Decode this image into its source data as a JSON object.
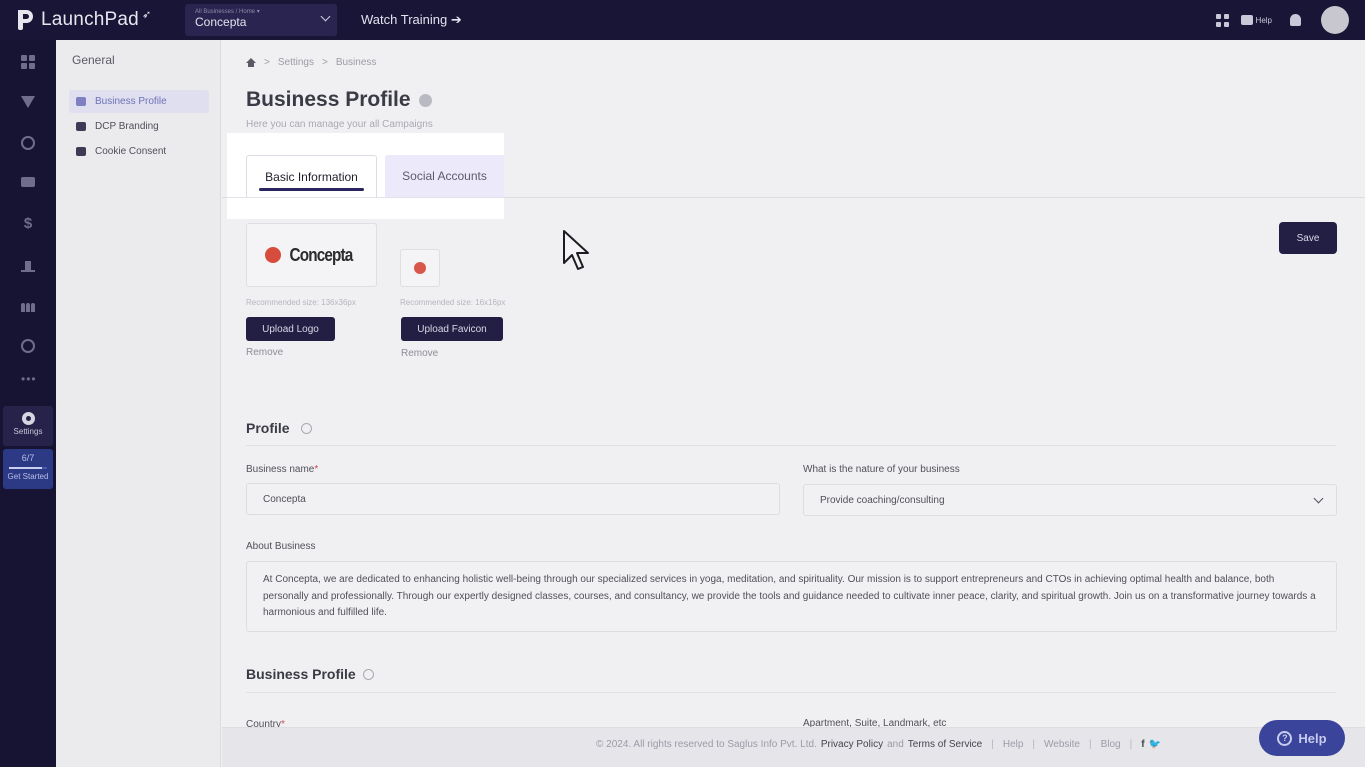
{
  "brand": {
    "name": "LaunchPad",
    "leaf_glyph": "➶"
  },
  "topbar": {
    "business_small": "All Businesses / Home ▾",
    "business_name": "Concepta",
    "watch_training": "Watch Training ➔",
    "help_label": "Help"
  },
  "rail": {
    "settings_label": "Settings",
    "progress_count": "6/7",
    "progress_fraction": 0.857,
    "get_started": "Get Started",
    "more": "•••"
  },
  "subnav": {
    "title": "General",
    "items": [
      {
        "label": "Business Profile",
        "active": true
      },
      {
        "label": "DCP Branding",
        "active": false
      },
      {
        "label": "Cookie Consent",
        "active": false
      }
    ]
  },
  "breadcrumb": {
    "items": [
      "Settings",
      "Business"
    ],
    "sep": ">"
  },
  "page": {
    "title": "Business Profile",
    "subtitle": "Here you can manage your all Campaigns"
  },
  "tabs": [
    {
      "label": "Basic Information",
      "active": true
    },
    {
      "label": "Social Accounts",
      "active": false
    }
  ],
  "branding": {
    "logo_text": "Concepta",
    "logo_rec": "Recommended size: 136x36px",
    "favicon_rec": "Recommended size: 16x16px",
    "upload_logo": "Upload Logo",
    "upload_favicon": "Upload Favicon",
    "remove": "Remove",
    "save": "Save"
  },
  "profile": {
    "section_title": "Profile",
    "business_name_label": "Business name",
    "business_name_value": "Concepta",
    "nature_label": "What is the nature of your business",
    "nature_value": "Provide coaching/consulting",
    "about_label": "About Business",
    "about_value": "At Concepta, we are dedicated to enhancing holistic well-being through our specialized services in yoga, meditation, and spirituality. Our mission is to support entrepreneurs and CTOs in achieving optimal health and balance, both personally and professionally. Through our expertly designed classes, courses, and consultancy, we provide the tools and guidance needed to cultivate inner peace, clarity, and spiritual growth. Join us on a transformative journey towards a harmonious and fulfilled life."
  },
  "business_profile": {
    "section_title": "Business Profile",
    "country_label": "Country",
    "apartment_label": "Apartment, Suite, Landmark, etc"
  },
  "footer": {
    "copyright": "© 2024. All rights reserved to Saglus Info Pvt. Ltd.",
    "privacy": "Privacy Policy",
    "and": "and",
    "terms": "Terms of Service",
    "help": "Help",
    "website": "Website",
    "blog": "Blog",
    "facebook": "f",
    "twitter": "🐦"
  },
  "help_float": {
    "label": "Help",
    "icon_glyph": "?"
  },
  "colors": {
    "topbar": "#191537",
    "rail": "#171433",
    "primary_button": "#221e44",
    "tab_active_underline": "#2a2460",
    "help_float": "#39449a",
    "subnav_active": "#6e72b5"
  }
}
